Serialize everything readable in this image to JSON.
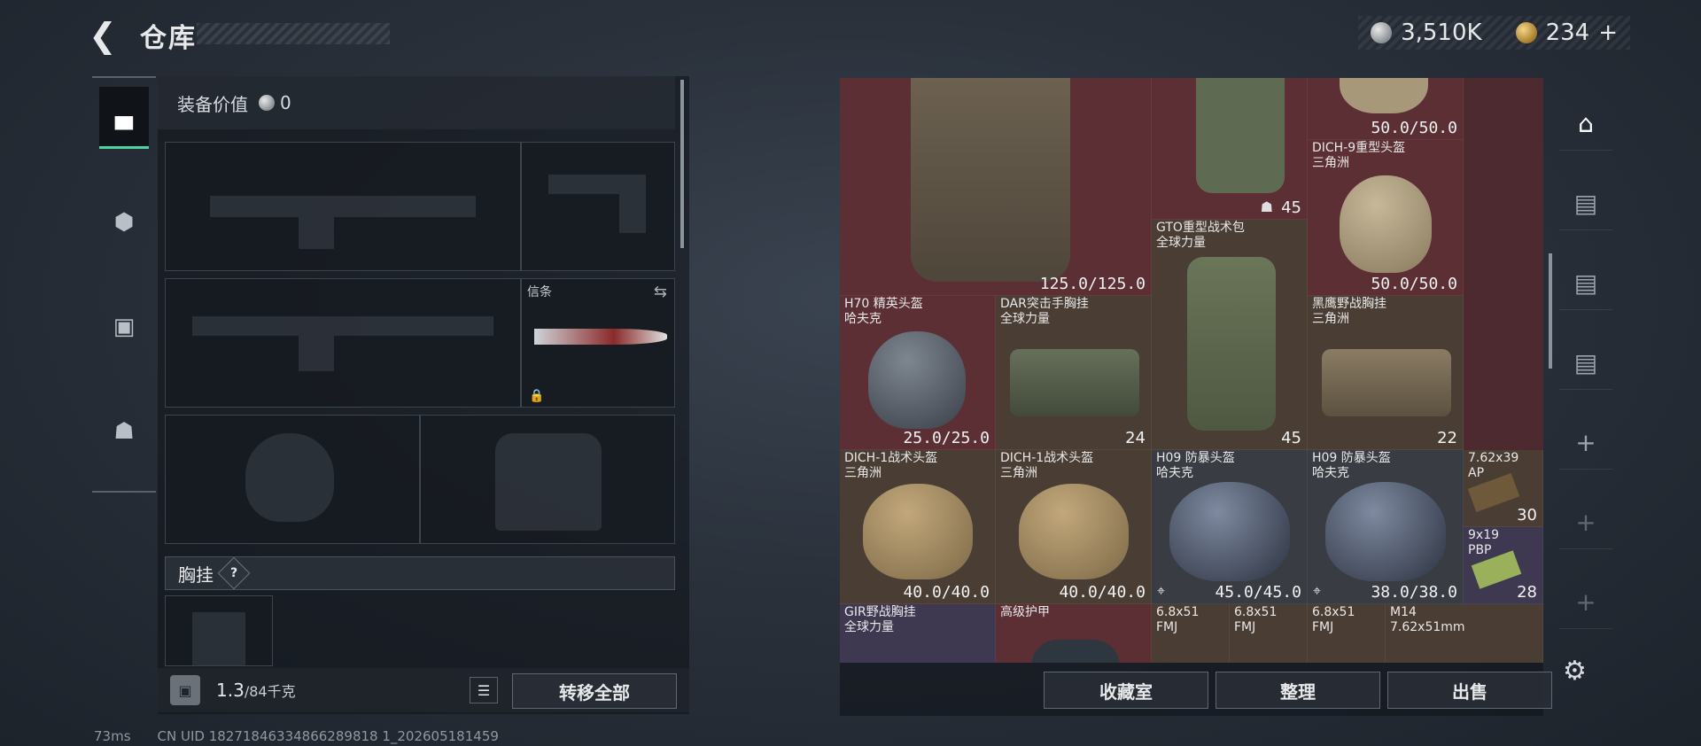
{
  "header": {
    "title": "仓库"
  },
  "currency": {
    "silver": "3,510K",
    "gold": "234",
    "gold_plus": "+"
  },
  "loadout": {
    "equip_value_label": "装备价值",
    "equip_value": "0",
    "melee_slot_label": "信条",
    "chest_rig_label": "胸挂",
    "help_label": "?",
    "weight_current": "1.3",
    "weight_max": "/84千克",
    "transfer_all": "转移全部"
  },
  "stash": {
    "items": [
      {
        "name": "",
        "sub": "",
        "value": "125.0/125.0"
      },
      {
        "name": "",
        "sub": "",
        "value": "45"
      },
      {
        "name": "",
        "sub": "",
        "value": "50.0/50.0"
      },
      {
        "name": "DICH-9重型头盔",
        "sub": "三角洲",
        "value": "50.0/50.0"
      },
      {
        "name": "GTO重型战术包",
        "sub": "全球力量",
        "value": "45"
      },
      {
        "name": "H70 精英头盔",
        "sub": "哈夫克",
        "value": "25.0/25.0"
      },
      {
        "name": "DAR突击手胸挂",
        "sub": "全球力量",
        "value": "24"
      },
      {
        "name": "黑鹰野战胸挂",
        "sub": "三角洲",
        "value": "22"
      },
      {
        "name": "DICH-1战术头盔",
        "sub": "三角洲",
        "value": "40.0/40.0"
      },
      {
        "name": "DICH-1战术头盔",
        "sub": "三角洲",
        "value": "40.0/40.0"
      },
      {
        "name": "H09 防暴头盔",
        "sub": "哈夫克",
        "value": "45.0/45.0"
      },
      {
        "name": "H09 防暴头盔",
        "sub": "哈夫克",
        "value": "38.0/38.0"
      },
      {
        "name": "7.62x39",
        "sub": "AP",
        "value": "30"
      },
      {
        "name": "9x19",
        "sub": "PBP",
        "value": "28"
      },
      {
        "name": "GIR野战胸挂",
        "sub": "全球力量",
        "value": ""
      },
      {
        "name": "高级护甲",
        "sub": "",
        "value": ""
      },
      {
        "name": "6.8x51",
        "sub": "FMJ",
        "value": ""
      },
      {
        "name": "6.8x51",
        "sub": "FMJ",
        "value": ""
      },
      {
        "name": "6.8x51",
        "sub": "FMJ",
        "value": ""
      },
      {
        "name": "M14",
        "sub": "7.62x51mm",
        "value": ""
      }
    ],
    "buttons": {
      "collection": "收藏室",
      "sort": "整理",
      "sell": "出售"
    }
  },
  "status": {
    "ping": "73ms",
    "uid": "CN UID 18271846334866289818 1_202605181459"
  },
  "colors": {
    "accent": "#4fd1a3",
    "red_tile": "#5b2f34",
    "brown_tile": "#4a3d34"
  }
}
